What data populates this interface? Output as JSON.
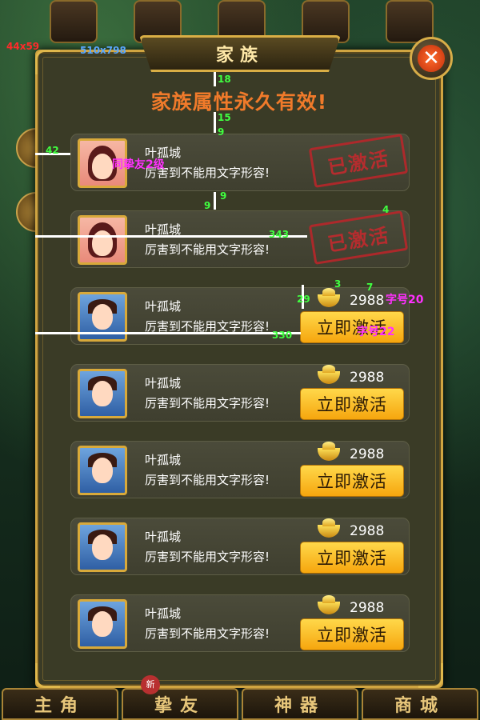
{
  "window": {
    "title": "家族",
    "subtitle": "家族属性永久有效!"
  },
  "cards": [
    {
      "name": "叶孤城",
      "desc": "厉害到不能用文字形容!",
      "state": "active",
      "stamp": "已激活",
      "avatar": "female"
    },
    {
      "name": "叶孤城",
      "desc": "厉害到不能用文字形容!",
      "state": "active",
      "stamp": "已激活",
      "avatar": "female"
    },
    {
      "name": "叶孤城",
      "desc": "厉害到不能用文字形容!",
      "state": "buy",
      "price": "2988",
      "button": "立即激活",
      "avatar": "male"
    },
    {
      "name": "叶孤城",
      "desc": "厉害到不能用文字形容!",
      "state": "buy",
      "price": "2988",
      "button": "立即激活",
      "avatar": "male"
    },
    {
      "name": "叶孤城",
      "desc": "厉害到不能用文字形容!",
      "state": "buy",
      "price": "2988",
      "button": "立即激活",
      "avatar": "male"
    },
    {
      "name": "叶孤城",
      "desc": "厉害到不能用文字形容!",
      "state": "buy",
      "price": "2988",
      "button": "立即激活",
      "avatar": "male"
    },
    {
      "name": "叶孤城",
      "desc": "厉害到不能用文字形容!",
      "state": "buy",
      "price": "2988",
      "button": "立即激活",
      "avatar": "male"
    }
  ],
  "nav": {
    "tabs": [
      "主角",
      "挚友",
      "神器",
      "商城"
    ],
    "badge": "新"
  },
  "annotations": {
    "size_small": "44x59",
    "size_panel": "510x798",
    "m18": "18",
    "m15": "15",
    "m9a": "9",
    "m9b": "9",
    "m9c": "9",
    "m42": "42",
    "m4": "4",
    "m343": "343",
    "m3": "3",
    "m7": "7",
    "m29": "29",
    "m330": "330",
    "tag_friend": "同挚友2级",
    "tag_font20": "字号20",
    "tag_font22": "字号22"
  },
  "colors": {
    "gold": "#d9ae45",
    "subtitle": "#f07a2a",
    "button": "#f6a60e",
    "stamp": "#b8262a"
  }
}
